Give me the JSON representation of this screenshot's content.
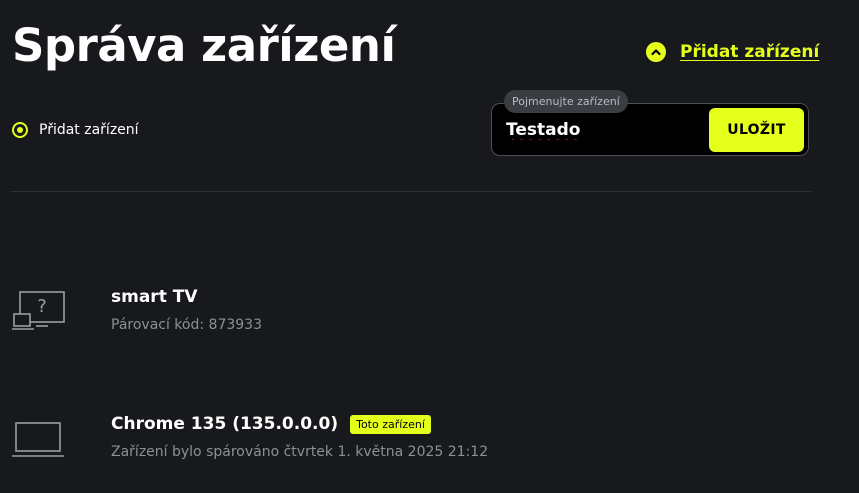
{
  "page": {
    "title": "Správa zařízení"
  },
  "header": {
    "add_device_link": "Přidat zařízení"
  },
  "add_option": {
    "label": "Přidat zařízení"
  },
  "name_field": {
    "floating_label": "Pojmenujte zařízení",
    "value": "Testado"
  },
  "save_button": {
    "label": "ULOŽIT"
  },
  "devices": [
    {
      "name": "smart TV",
      "detail": "Párovací kód: 873933",
      "icon": "unknown-device-icon"
    },
    {
      "name": "Chrome 135 (135.0.0.0)",
      "badge": "Toto zařízení",
      "detail": "Zařízení bylo spárováno čtvrtek 1. května 2025 21:12",
      "icon": "laptop-icon"
    }
  ],
  "colors": {
    "accent": "#e4ff1a",
    "background": "#17191c",
    "muted_text": "#8c9096"
  }
}
